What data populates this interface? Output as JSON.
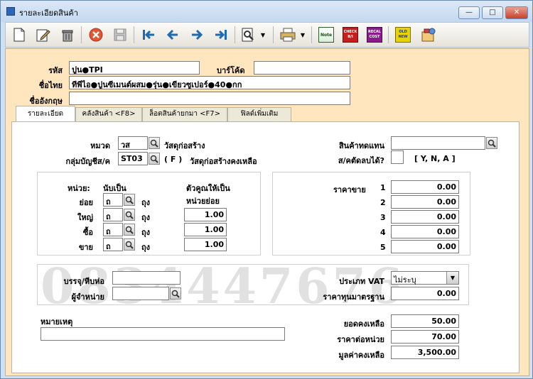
{
  "window": {
    "title": "รายละเอียดสินค้า",
    "min": "—",
    "max": "□",
    "close": "✕"
  },
  "toolbar": {
    "note": "Note",
    "check": "CHECK",
    "check2": "B/I",
    "recal": "RECAL",
    "cost": "COST",
    "old": "OLD",
    "new": "NEW"
  },
  "header": {
    "code_label": "รหัส",
    "code_value": "ปูน●TPI",
    "barcode_label": "บาร์โค้ด",
    "barcode_value": "",
    "thai_name_label": "ชื่อไทย",
    "thai_name_value": "ทีพีไอ●ปูนซีเมนต์ผสม●รุ่น●เขียวซูเปอร์●40●กก",
    "eng_name_label": "ชื่ออังกฤษ",
    "eng_name_value": ""
  },
  "tabs": [
    {
      "label": "รายละเอียด"
    },
    {
      "label": "คลังสินค้า <F8>"
    },
    {
      "label": "ล็อตสินค้ายกมา <F7>"
    },
    {
      "label": "ฟิลด์เพิ่มเติม"
    }
  ],
  "detail": {
    "category_label": "หมวด",
    "category_code": "วส",
    "category_name": "วัสดุก่อสร้าง",
    "account_label": "กลุ่มบัญชีส/ค",
    "account_code": "ST03",
    "account_flag": "( F )",
    "account_name": "วัสดุก่อสร้างคงเหลือ",
    "substitute_label": "สินค้าทดแทน",
    "substitute_value": "",
    "deletable_label": "ส/คตัดลบได้?",
    "deletable_value": "",
    "deletable_options": "[ Y, N, A ]"
  },
  "units": {
    "unit_header": "หน่วย:",
    "count_header": "นับเป็น",
    "multiplier_header": "ตัวคูณให้เป็น",
    "multiplier_sub": "หน่วยย่อย",
    "rows": [
      {
        "label": "ย่อย",
        "code": "ถ",
        "name": "ถุง",
        "multiplier": ""
      },
      {
        "label": "ใหญ่",
        "code": "ถ",
        "name": "ถุง",
        "multiplier": "1.00"
      },
      {
        "label": "ซื้อ",
        "code": "ถ",
        "name": "ถุง",
        "multiplier": "1.00"
      },
      {
        "label": "ขาย",
        "code": "ถ",
        "name": "ถุง",
        "multiplier": "1.00"
      }
    ]
  },
  "prices": {
    "label": "ราคาขาย",
    "rows": [
      {
        "n": "1",
        "value": "0.00"
      },
      {
        "n": "2",
        "value": "0.00"
      },
      {
        "n": "3",
        "value": "0.00"
      },
      {
        "n": "4",
        "value": "0.00"
      },
      {
        "n": "5",
        "value": "0.00"
      }
    ]
  },
  "watermark": "0834447676",
  "packing": {
    "pack_label": "บรรจุ/หีบห่อ",
    "pack_value": "",
    "vendor_label": "ผู้จำหน่าย",
    "vendor_value": ""
  },
  "vat": {
    "type_label": "ประเภท VAT",
    "type_value": "ไม่ระบุ",
    "std_cost_label": "ราคาทุนมาตรฐาน",
    "std_cost_value": "0.00"
  },
  "remark": {
    "label": "หมายเหตุ",
    "value": ""
  },
  "totals": {
    "balance_label": "ยอดคงเหลือ",
    "balance_value": "50.00",
    "unit_price_label": "ราคาต่อหน่วย",
    "unit_price_value": "70.00",
    "total_value_label": "มูลค่าคงเหลือ",
    "total_value_value": "3,500.00"
  }
}
